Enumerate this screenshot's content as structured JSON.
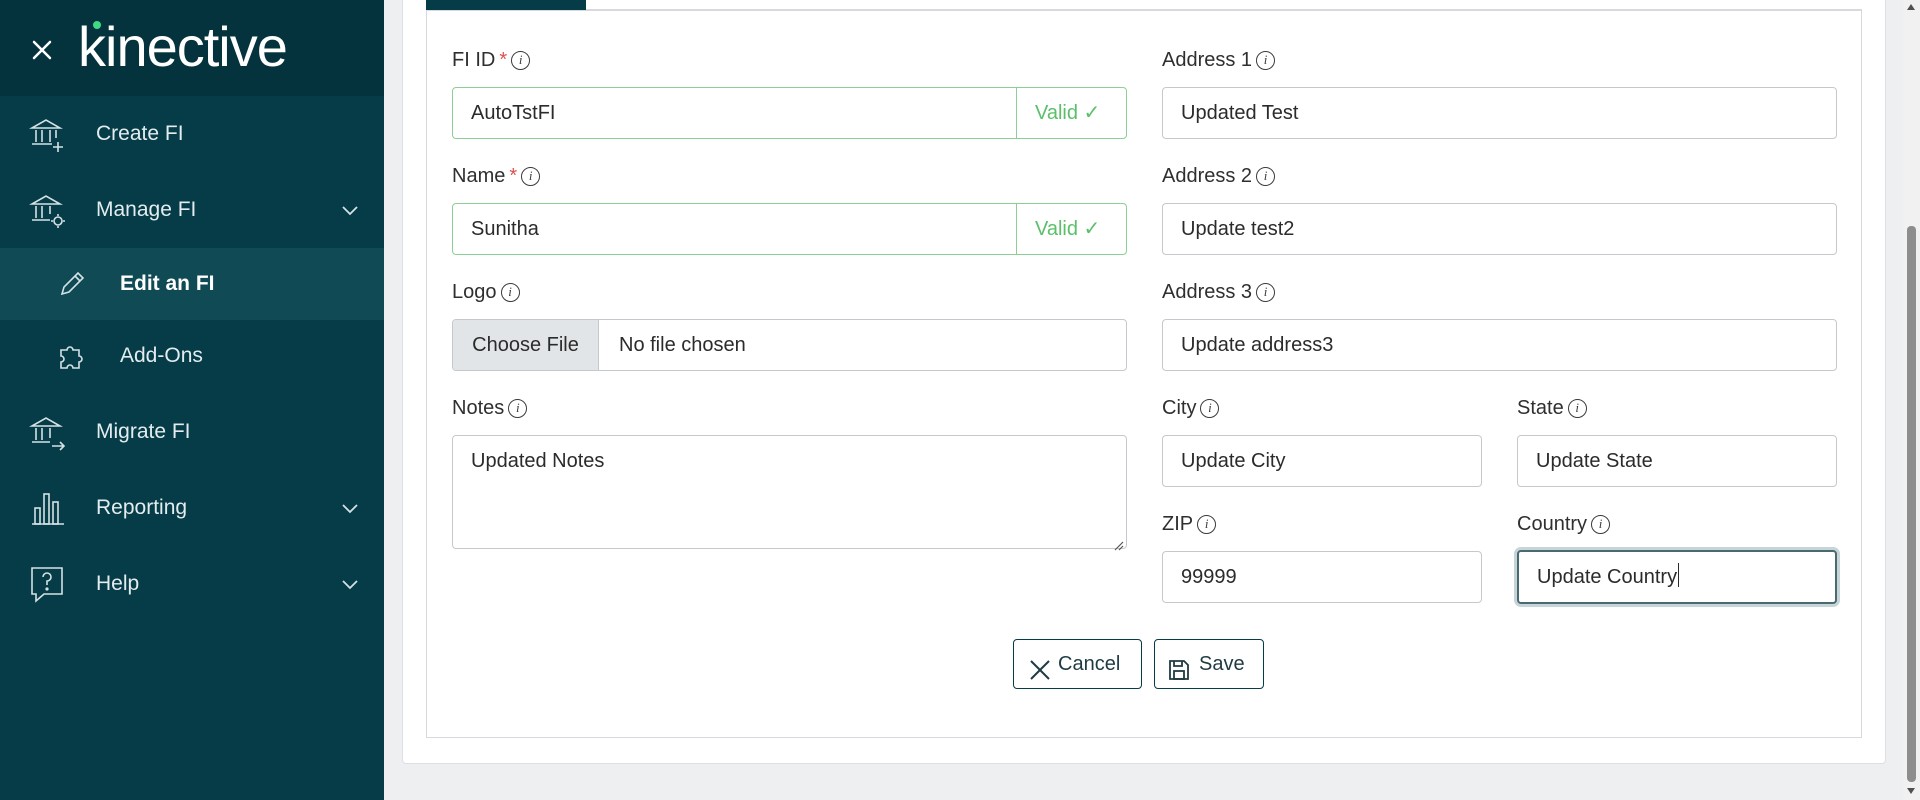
{
  "sidebar": {
    "logo": "kinective",
    "items": [
      {
        "label": "Create FI",
        "icon": "bank-plus-icon"
      },
      {
        "label": "Manage FI",
        "icon": "bank-gear-icon"
      },
      {
        "label": "Edit an FI",
        "icon": "pencil-icon"
      },
      {
        "label": "Add-Ons",
        "icon": "puzzle-icon"
      },
      {
        "label": "Migrate FI",
        "icon": "bank-arrow-icon"
      },
      {
        "label": "Reporting",
        "icon": "bar-chart-icon"
      },
      {
        "label": "Help",
        "icon": "help-bubble-icon"
      }
    ]
  },
  "form": {
    "fi_id": {
      "label": "FI ID",
      "required": "*",
      "value": "AutoTstFI",
      "status": "Valid ✓"
    },
    "name": {
      "label": "Name",
      "required": "*",
      "value": "Sunitha",
      "status": "Valid ✓"
    },
    "logo": {
      "label": "Logo",
      "button": "Choose File",
      "file_text": "No file chosen"
    },
    "notes": {
      "label": "Notes",
      "value": "Updated Notes"
    },
    "address1": {
      "label": "Address 1",
      "value": "Updated Test"
    },
    "address2": {
      "label": "Address 2",
      "value": "Update test2"
    },
    "address3": {
      "label": "Address 3",
      "value": "Update address3"
    },
    "city": {
      "label": "City",
      "value": "Update City"
    },
    "state": {
      "label": "State",
      "value": "Update State"
    },
    "zip": {
      "label": "ZIP",
      "value": "99999"
    },
    "country": {
      "label": "Country",
      "value": "Update Country"
    },
    "info_glyph": "i"
  },
  "actions": {
    "cancel": "Cancel",
    "save": "Save"
  },
  "colors": {
    "sidebar_bg": "#053c47",
    "valid_green": "#5bbf6a",
    "required_red": "#d9534f"
  }
}
